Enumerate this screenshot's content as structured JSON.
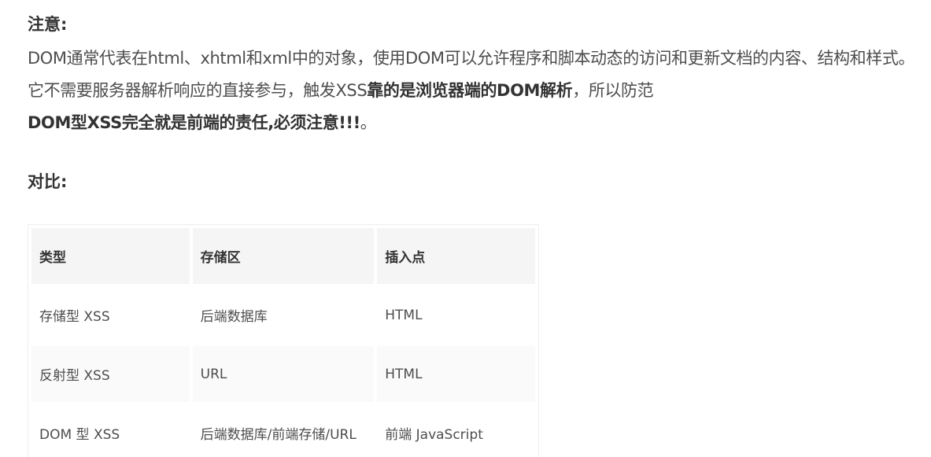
{
  "note_heading": "注意:",
  "paragraph": {
    "part1": "DOM通常代表在html、xhtml和xml中的对象，使用DOM可以允许程序和脚本动态的访问和更新文档的内容、结构和样式。它不需要服务器解析响应的直接参与，触发XSS",
    "bold1": "靠的是浏览器端的DOM解析",
    "part2": "，所以防范",
    "bold2": "DOM型XSS完全就是前端的责任,必须注意!!!",
    "part3": "。"
  },
  "compare_heading": "对比:",
  "table": {
    "headers": [
      "类型",
      "存储区",
      "插入点"
    ],
    "rows": [
      [
        "存储型 XSS",
        "后端数据库",
        "HTML"
      ],
      [
        "反射型 XSS",
        "URL",
        "HTML"
      ],
      [
        "DOM 型 XSS",
        "后端数据库/前端存储/URL",
        "前端 JavaScript"
      ]
    ]
  }
}
